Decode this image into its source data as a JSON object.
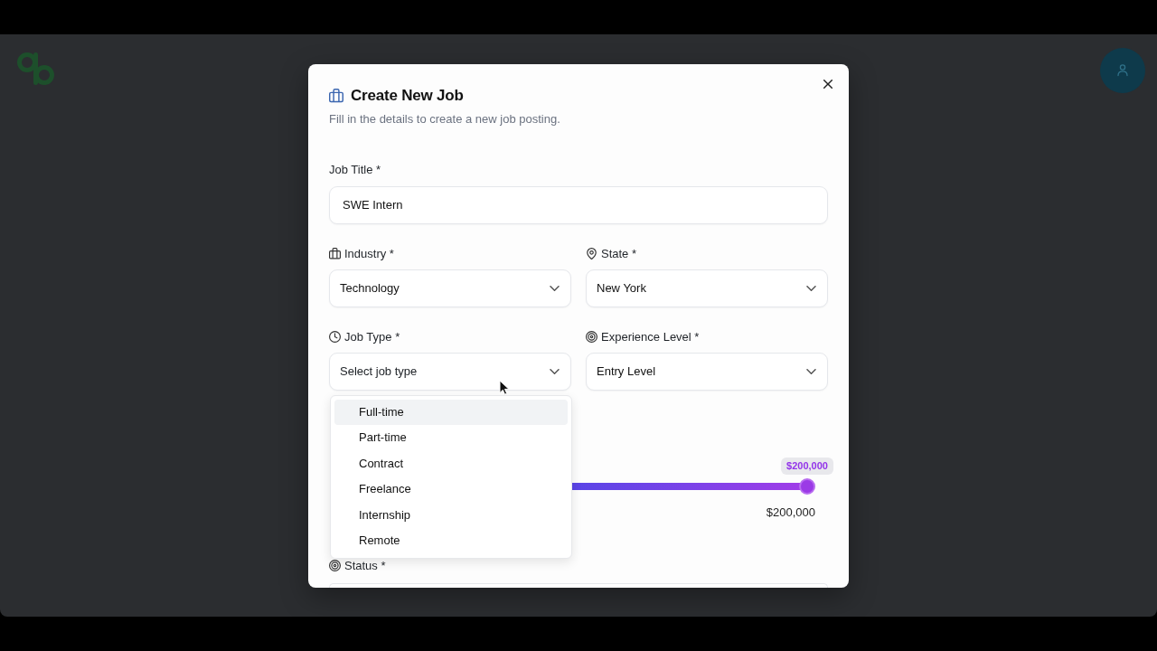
{
  "dialog": {
    "title": "Create New Job",
    "subtitle": "Fill in the details to create a new job posting.",
    "fields": {
      "job_title": {
        "label": "Job Title *",
        "value": "SWE Intern"
      },
      "industry": {
        "label": "Industry *",
        "value": "Technology"
      },
      "state": {
        "label": "State *",
        "value": "New York"
      },
      "job_type": {
        "label": "Job Type *",
        "placeholder": "Select job type",
        "expanded": true,
        "options": [
          {
            "label": "Full-time",
            "highlighted": true,
            "selected": false
          },
          {
            "label": "Part-time",
            "highlighted": false,
            "selected": false
          },
          {
            "label": "Contract",
            "highlighted": false,
            "selected": false
          },
          {
            "label": "Freelance",
            "highlighted": false,
            "selected": false
          },
          {
            "label": "Internship",
            "highlighted": false,
            "selected": false
          },
          {
            "label": "Remote",
            "highlighted": false,
            "selected": false
          }
        ]
      },
      "experience_level": {
        "label": "Experience Level *",
        "value": "Entry Level"
      },
      "salary": {
        "level": 1,
        "value_badge": "$200,000",
        "max_label": "$200,000"
      },
      "status": {
        "label": "Status *"
      }
    }
  }
}
